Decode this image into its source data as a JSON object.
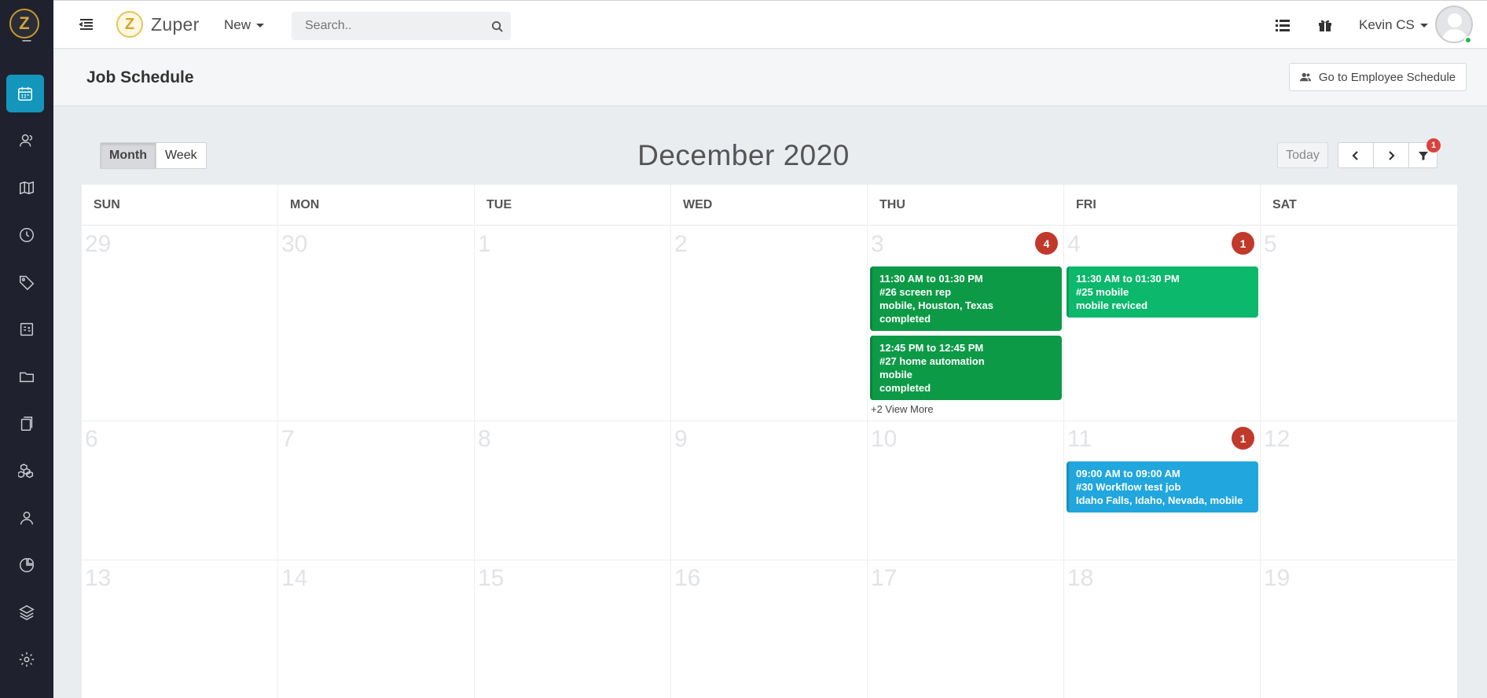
{
  "app": {
    "brand": "Zuper",
    "logo_letter": "Z",
    "new_label": "New",
    "search_placeholder": "Search..",
    "user_name": "Kevin CS"
  },
  "sidebar": {
    "items": [
      {
        "icon": "partial-icon"
      },
      {
        "icon": "calendar-icon",
        "active": true
      },
      {
        "icon": "contacts-icon"
      },
      {
        "icon": "map-icon"
      },
      {
        "icon": "clock-icon"
      },
      {
        "icon": "tag-icon"
      },
      {
        "icon": "invoice-icon"
      },
      {
        "icon": "folder-icon"
      },
      {
        "icon": "documents-icon"
      },
      {
        "icon": "boxes-icon"
      },
      {
        "icon": "user-icon"
      },
      {
        "icon": "reports-icon"
      },
      {
        "icon": "layers-icon"
      },
      {
        "icon": "settings-icon"
      }
    ]
  },
  "page": {
    "title": "Job Schedule",
    "employee_schedule_button": "Go to Employee Schedule"
  },
  "calendar": {
    "view_month": "Month",
    "view_week": "Week",
    "active_view": "Month",
    "month_title": "December 2020",
    "today_label": "Today",
    "filter_badge": "1",
    "weekdays": [
      "SUN",
      "MON",
      "TUE",
      "WED",
      "THU",
      "FRI",
      "SAT"
    ],
    "weeks": [
      {
        "days": [
          {
            "num": "29"
          },
          {
            "num": "30"
          },
          {
            "num": "1"
          },
          {
            "num": "2"
          },
          {
            "num": "3",
            "badge": "4",
            "view_more": "+2 View More",
            "events": [
              {
                "time": "11:30 AM to 01:30 PM",
                "title": "#26 screen rep",
                "detail": "mobile, Houston, Texas",
                "status": "completed",
                "color": "green"
              },
              {
                "time": "12:45 PM to 12:45 PM",
                "title": "#27 home automation",
                "detail": "mobile",
                "status": "completed",
                "color": "green"
              }
            ]
          },
          {
            "num": "4",
            "badge": "1",
            "events": [
              {
                "time": "11:30 AM to 01:30 PM",
                "title": "#25 mobile",
                "detail": "mobile reviced",
                "color": "teal"
              }
            ]
          },
          {
            "num": "5"
          }
        ]
      },
      {
        "days": [
          {
            "num": "6"
          },
          {
            "num": "7"
          },
          {
            "num": "8"
          },
          {
            "num": "9"
          },
          {
            "num": "10"
          },
          {
            "num": "11",
            "badge": "1",
            "events": [
              {
                "time": "09:00 AM to 09:00 AM",
                "title": "#30 Workflow test job",
                "detail": "Idaho Falls, Idaho, Nevada, mobile",
                "color": "blue"
              }
            ]
          },
          {
            "num": "12"
          }
        ]
      },
      {
        "days": [
          {
            "num": "13"
          },
          {
            "num": "14"
          },
          {
            "num": "15"
          },
          {
            "num": "16"
          },
          {
            "num": "17"
          },
          {
            "num": "18"
          },
          {
            "num": "19"
          }
        ]
      }
    ]
  }
}
